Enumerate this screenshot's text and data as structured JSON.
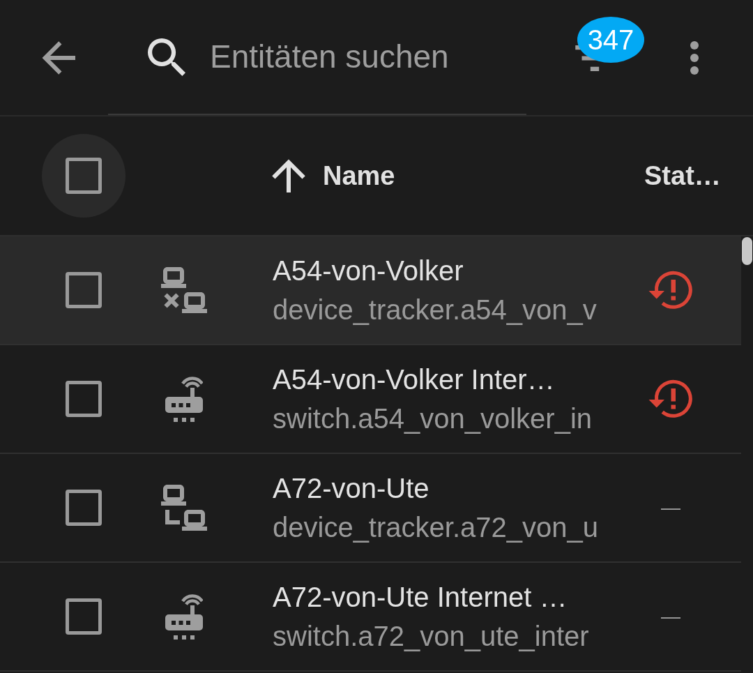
{
  "toolbar": {
    "search": {
      "placeholder": "Entitäten suchen"
    },
    "filter_count": "347"
  },
  "table": {
    "select_all": {
      "checked": false,
      "hovered": true
    },
    "columns": [
      {
        "label": "Name",
        "sorted": true
      },
      {
        "label": "Stat…",
        "sorted": false
      }
    ],
    "rows": [
      {
        "kind": "device_tracker",
        "connected": false,
        "name": "A54-von-Volker",
        "entity_id": "device_tracker.a54_von_v",
        "checked": false,
        "hovered": true,
        "restored": true
      },
      {
        "kind": "switch",
        "name": "A54-von-Volker Inter…",
        "entity_id": "switch.a54_von_volker_in",
        "checked": false,
        "hovered": false,
        "restored": true
      },
      {
        "kind": "device_tracker",
        "connected": true,
        "name": "A72-von-Ute",
        "entity_id": "device_tracker.a72_von_u",
        "checked": false,
        "hovered": false,
        "restored": false,
        "status": "—"
      },
      {
        "kind": "switch",
        "name": "A72-von-Ute Internet …",
        "entity_id": "switch.a72_von_ute_inter",
        "checked": false,
        "hovered": false,
        "restored": false,
        "status": "—"
      }
    ]
  }
}
